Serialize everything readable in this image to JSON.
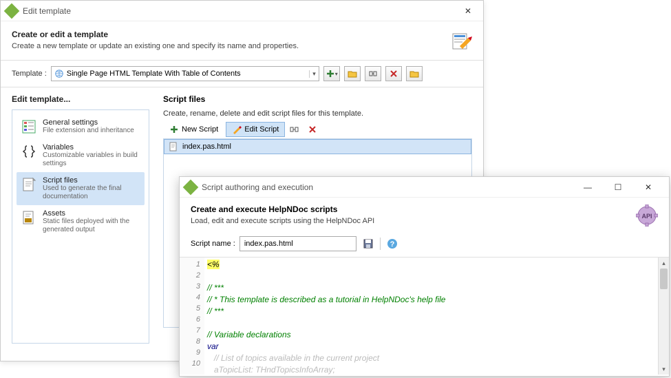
{
  "win1": {
    "title": "Edit template",
    "header_title": "Create or edit a template",
    "header_desc": "Create a new template or update an existing one and specify its name and properties.",
    "template_label": "Template :",
    "template_value": "Single Page HTML Template With Table of Contents",
    "sidebar_title": "Edit template...",
    "sidebar_items": [
      {
        "title": "General settings",
        "desc": "File extension and inheritance"
      },
      {
        "title": "Variables",
        "desc": "Customizable variables in build settings"
      },
      {
        "title": "Script files",
        "desc": "Used to generate the final documentation"
      },
      {
        "title": "Assets",
        "desc": "Static files deployed with the generated output"
      }
    ],
    "content_title": "Script files",
    "content_desc": "Create, rename, delete and edit script files for this template.",
    "toolbar": {
      "new": "New Script",
      "edit": "Edit Script"
    },
    "file": "index.pas.html"
  },
  "win2": {
    "title": "Script authoring and execution",
    "header_title": "Create and execute HelpNDoc scripts",
    "header_desc": "Load, edit and execute scripts using the HelpNDoc API",
    "script_name_label": "Script name :",
    "script_name_value": "index.pas.html",
    "code": {
      "l1": "<%",
      "l3": "// ***",
      "l4": "// * This template is described as a tutorial in HelpNDoc's help file",
      "l5": "// ***",
      "l7": "// Variable declarations",
      "l8": "var",
      "l9": "   // List of topics available in the current project",
      "l10": "   aTopicList: THndTopicsInfoArray;"
    },
    "lines": [
      "1",
      "2",
      "3",
      "4",
      "5",
      "6",
      "7",
      "8",
      "9",
      "10"
    ]
  }
}
